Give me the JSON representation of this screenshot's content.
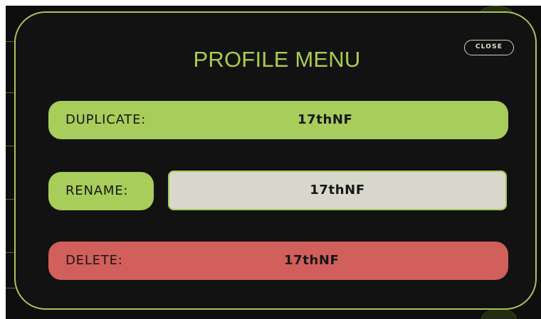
{
  "profile_menu": {
    "title": "PROFILE MENU",
    "close_label": "CLOSE",
    "duplicate": {
      "label": "DUPLICATE:",
      "value": "17thNF"
    },
    "rename": {
      "label": "RENAME:",
      "value": "17thNF"
    },
    "delete": {
      "label": "DELETE:",
      "value": "17thNF"
    }
  },
  "colors": {
    "accent_green": "#a8cd5a",
    "danger_red": "#d15f5b",
    "input_background": "#d7d8cb",
    "modal_background": "#121212"
  }
}
